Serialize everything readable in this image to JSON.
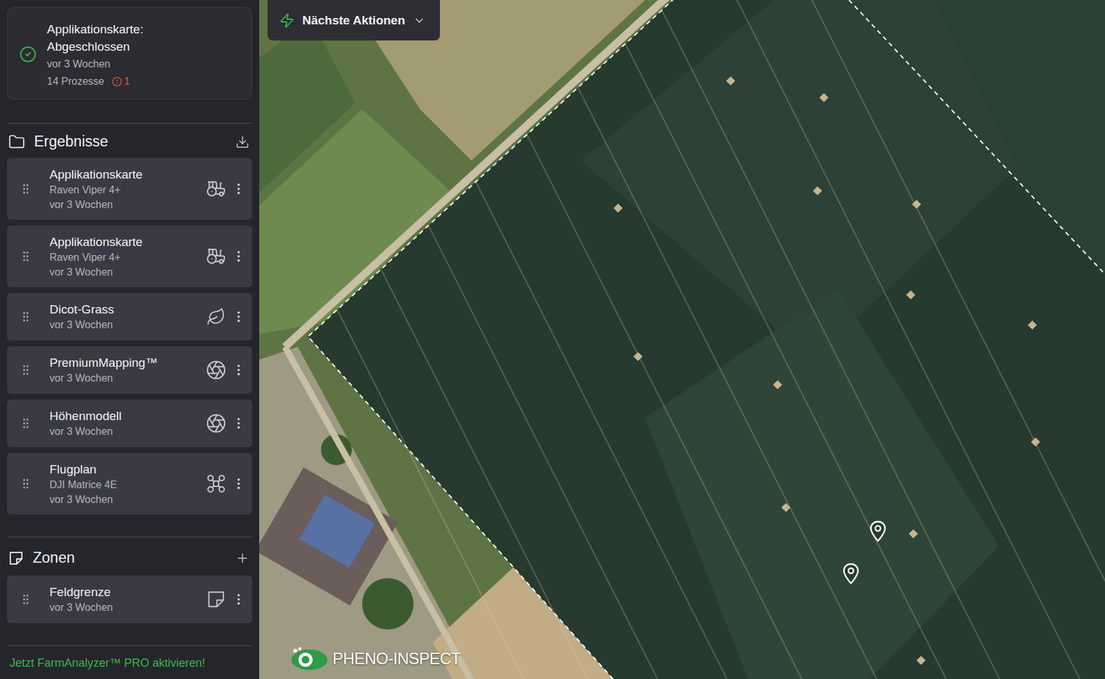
{
  "status": {
    "title": "Applikationskarte: Abgeschlossen",
    "time": "vor 3 Wochen",
    "processes": "14 Prozesse",
    "errors": "1"
  },
  "results": {
    "title": "Ergebnisse",
    "items": [
      {
        "title": "Applikationskarte",
        "subtitle": "Raven Viper 4+",
        "time": "vor 3 Wochen",
        "kind": "tractor"
      },
      {
        "title": "Applikationskarte",
        "subtitle": "Raven Viper 4+",
        "time": "vor 3 Wochen",
        "kind": "tractor"
      },
      {
        "title": "Dicot-Grass",
        "subtitle": "",
        "time": "vor 3 Wochen",
        "kind": "leaf"
      },
      {
        "title": "PremiumMapping™",
        "subtitle": "",
        "time": "vor 3 Wochen",
        "kind": "aperture"
      },
      {
        "title": "Höhenmodell",
        "subtitle": "",
        "time": "vor 3 Wochen",
        "kind": "aperture"
      },
      {
        "title": "Flugplan",
        "subtitle": "DJI Matrice 4E",
        "time": "vor 3 Wochen",
        "kind": "drone"
      }
    ]
  },
  "zones": {
    "title": "Zonen",
    "items": [
      {
        "title": "Feldgrenze",
        "subtitle": "",
        "time": "vor 3 Wochen",
        "kind": "zone"
      }
    ]
  },
  "promo": "Jetzt FarmAnalyzer™ PRO aktivieren!",
  "map": {
    "actions_button": "Nächste Aktionen",
    "logo": "PHENO-INSPECT"
  }
}
